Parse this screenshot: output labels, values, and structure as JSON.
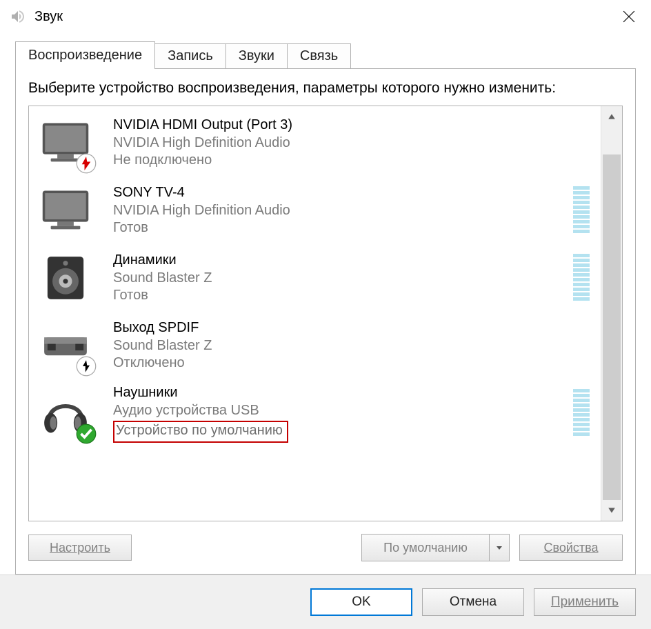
{
  "title": "Звук",
  "tabs": [
    {
      "label": "Воспроизведение",
      "active": true
    },
    {
      "label": "Запись",
      "active": false
    },
    {
      "label": "Звуки",
      "active": false
    },
    {
      "label": "Связь",
      "active": false
    }
  ],
  "instruction": "Выберите устройство воспроизведения, параметры которого нужно изменить:",
  "devices": [
    {
      "name": "NVIDIA HDMI Output (Port 3)",
      "subtitle": "NVIDIA High Definition Audio",
      "status": "Не подключено",
      "icon": "monitor",
      "badge": "unplugged",
      "meter": false,
      "highlight": false
    },
    {
      "name": "SONY TV-4",
      "subtitle": "NVIDIA High Definition Audio",
      "status": "Готов",
      "icon": "monitor",
      "badge": null,
      "meter": true,
      "highlight": false
    },
    {
      "name": "Динамики",
      "subtitle": "Sound Blaster Z",
      "status": "Готов",
      "icon": "speaker",
      "badge": null,
      "meter": true,
      "highlight": false
    },
    {
      "name": "Выход SPDIF",
      "subtitle": "Sound Blaster Z",
      "status": "Отключено",
      "icon": "spdif",
      "badge": "disabled",
      "meter": false,
      "highlight": false
    },
    {
      "name": "Наушники",
      "subtitle": "Аудио устройства USB",
      "status": "Устройство по умолчанию",
      "icon": "headphones",
      "badge": "default",
      "meter": true,
      "highlight": true
    }
  ],
  "panel_buttons": {
    "configure": "Настроить",
    "default": "По умолчанию",
    "properties": "Свойства"
  },
  "footer": {
    "ok": "OK",
    "cancel": "Отмена",
    "apply": "Применить"
  }
}
